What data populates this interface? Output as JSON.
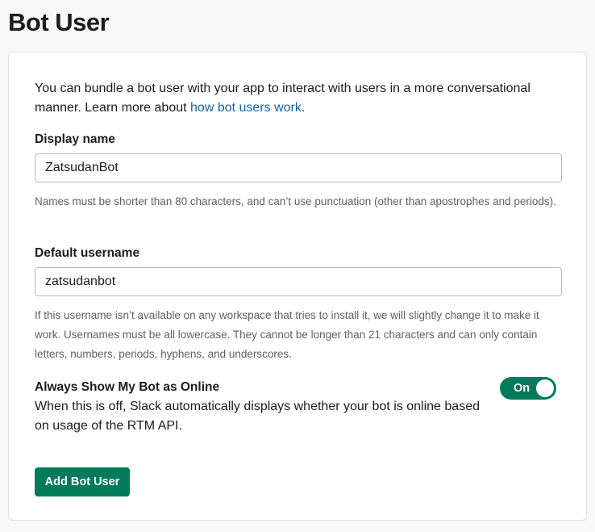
{
  "page": {
    "title": "Bot User"
  },
  "intro": {
    "text": "You can bundle a bot user with your app to interact with users in a more conversational manner. Learn more about ",
    "link_text": "how bot users work",
    "trailing": "."
  },
  "display_name": {
    "label": "Display name",
    "value": "ZatsudanBot",
    "hint": "Names must be shorter than 80 characters, and can’t use punctuation (other than apostrophes and periods)."
  },
  "default_username": {
    "label": "Default username",
    "value": "zatsudanbot",
    "hint": "If this username isn’t available on any workspace that tries to install it, we will slightly change it to make it work. Usernames must be all lowercase. They cannot be longer than 21 characters and can only contain letters, numbers, periods, hyphens, and underscores."
  },
  "online_toggle": {
    "title": "Always Show My Bot as Online",
    "description": "When this is off, Slack automatically displays whether your bot is online based on usage of the RTM API.",
    "state_label": "On",
    "enabled": true
  },
  "actions": {
    "add_button_label": "Add Bot User"
  },
  "colors": {
    "accent": "#007a5a",
    "link": "#1264a3",
    "hint_text": "#616061"
  }
}
